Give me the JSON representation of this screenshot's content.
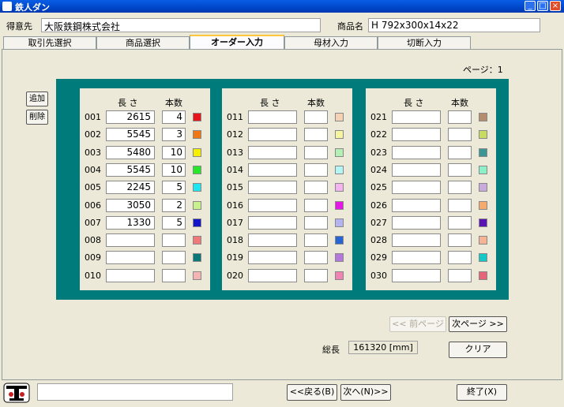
{
  "window": {
    "title": "鉄人ダン"
  },
  "header": {
    "customer_label": "得意先",
    "customer_value": "大阪鉄鋼株式会社",
    "product_label": "商品名",
    "product_value": "H 792x300x14x22"
  },
  "tabs": [
    {
      "label": "取引先選択"
    },
    {
      "label": "商品選択"
    },
    {
      "label": "オーダー入力"
    },
    {
      "label": "母材入力"
    },
    {
      "label": "切断入力"
    }
  ],
  "page_indicator": "ページ：1",
  "side_buttons": {
    "add": "追加",
    "delete": "削除"
  },
  "columns": {
    "length": "長 さ",
    "count": "本数"
  },
  "panels": [
    {
      "rows": [
        {
          "no": "001",
          "length": "2615",
          "count": "4",
          "color": "#e8141c"
        },
        {
          "no": "002",
          "length": "5545",
          "count": "3",
          "color": "#f07814"
        },
        {
          "no": "003",
          "length": "5480",
          "count": "10",
          "color": "#f5f000"
        },
        {
          "no": "004",
          "length": "5545",
          "count": "10",
          "color": "#28e628"
        },
        {
          "no": "005",
          "length": "2245",
          "count": "5",
          "color": "#1ee6f0"
        },
        {
          "no": "006",
          "length": "3050",
          "count": "2",
          "color": "#c8f08c"
        },
        {
          "no": "007",
          "length": "1330",
          "count": "5",
          "color": "#1414c8"
        },
        {
          "no": "008",
          "length": "",
          "count": "",
          "color": "#f07878"
        },
        {
          "no": "009",
          "length": "",
          "count": "",
          "color": "#0a7878"
        },
        {
          "no": "010",
          "length": "",
          "count": "",
          "color": "#f5b4b4"
        }
      ]
    },
    {
      "rows": [
        {
          "no": "011",
          "length": "",
          "count": "",
          "color": "#f5d2b4"
        },
        {
          "no": "012",
          "length": "",
          "count": "",
          "color": "#f5f5a0"
        },
        {
          "no": "013",
          "length": "",
          "count": "",
          "color": "#b4f0b4"
        },
        {
          "no": "014",
          "length": "",
          "count": "",
          "color": "#b4f5f5"
        },
        {
          "no": "015",
          "length": "",
          "count": "",
          "color": "#f5b4f0"
        },
        {
          "no": "016",
          "length": "",
          "count": "",
          "color": "#e614e6"
        },
        {
          "no": "017",
          "length": "",
          "count": "",
          "color": "#b4b4f0"
        },
        {
          "no": "018",
          "length": "",
          "count": "",
          "color": "#2864d2"
        },
        {
          "no": "019",
          "length": "",
          "count": "",
          "color": "#b478dc"
        },
        {
          "no": "020",
          "length": "",
          "count": "",
          "color": "#f082b4"
        }
      ]
    },
    {
      "rows": [
        {
          "no": "021",
          "length": "",
          "count": "",
          "color": "#b48c6e"
        },
        {
          "no": "022",
          "length": "",
          "count": "",
          "color": "#c8dc64"
        },
        {
          "no": "023",
          "length": "",
          "count": "",
          "color": "#3c9696"
        },
        {
          "no": "024",
          "length": "",
          "count": "",
          "color": "#8cf0c8"
        },
        {
          "no": "025",
          "length": "",
          "count": "",
          "color": "#c8aadc"
        },
        {
          "no": "026",
          "length": "",
          "count": "",
          "color": "#f5aa6e"
        },
        {
          "no": "027",
          "length": "",
          "count": "",
          "color": "#5a14b4"
        },
        {
          "no": "028",
          "length": "",
          "count": "",
          "color": "#f5b496"
        },
        {
          "no": "029",
          "length": "",
          "count": "",
          "color": "#14c8c8"
        },
        {
          "no": "030",
          "length": "",
          "count": "",
          "color": "#e66478"
        }
      ]
    }
  ],
  "nav": {
    "prev_page": "<< 前ページ",
    "next_page": "次ページ >>"
  },
  "total": {
    "label": "総長",
    "value": "161320 [mm]"
  },
  "clear_label": "クリア",
  "footer": {
    "back": "<<戻る(B)",
    "next": "次へ(N)>>",
    "exit": "終了(X)",
    "status": ""
  }
}
